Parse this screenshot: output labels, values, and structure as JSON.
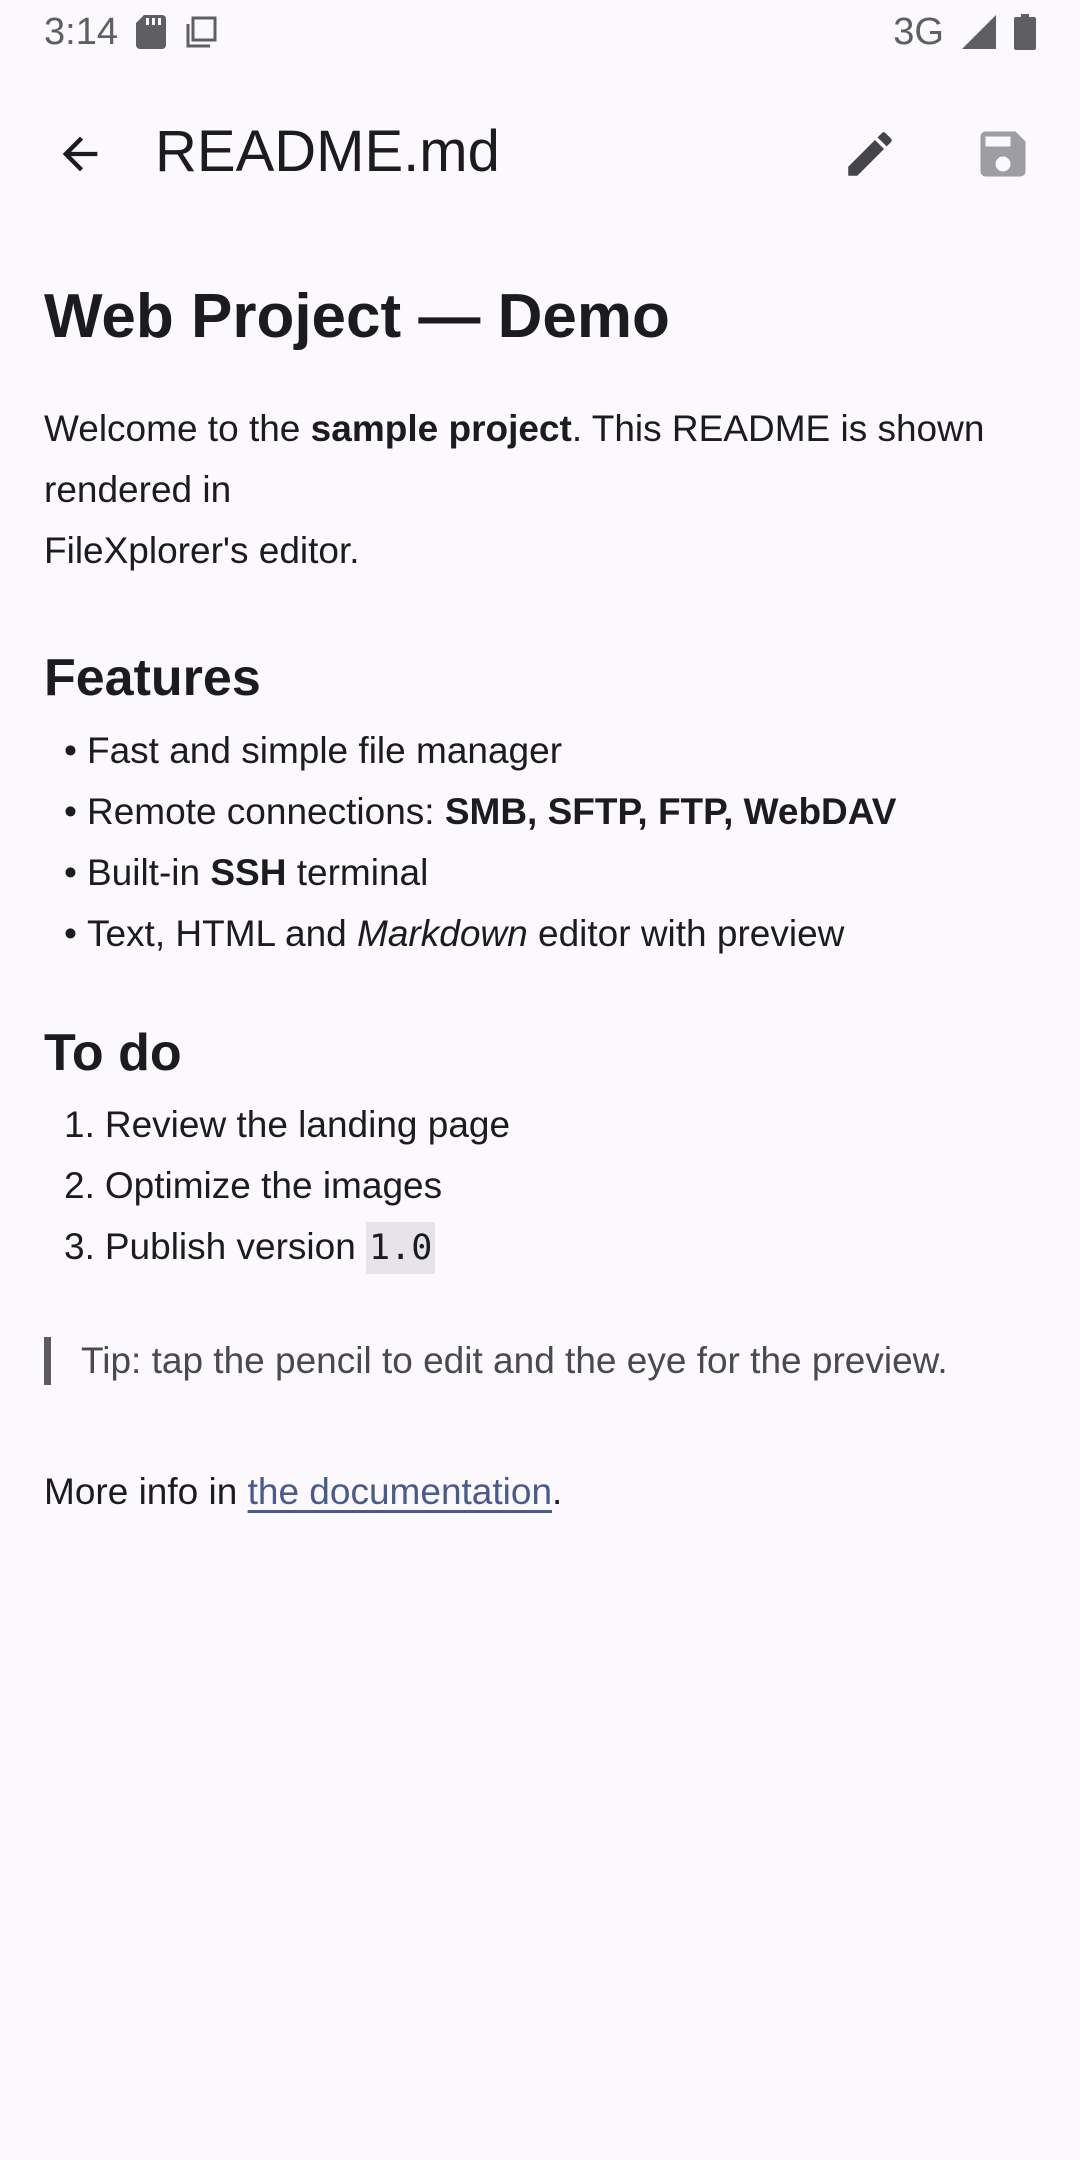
{
  "status_bar": {
    "time": "3:14",
    "network": "3G",
    "icons": [
      "sd-card-icon",
      "copy-icon",
      "signal-icon",
      "battery-icon"
    ]
  },
  "app_bar": {
    "title": "README.md",
    "icons": [
      "back-arrow-icon",
      "pencil-icon",
      "save-icon"
    ]
  },
  "document": {
    "title": "Web Project — Demo",
    "intro": {
      "pre": "Welcome to the ",
      "bold": "sample project",
      "post": ". This README is shown rendered in",
      "line2": "FileXplorer's editor."
    },
    "features": {
      "heading": "Features",
      "items": [
        {
          "pre": "Fast and simple file manager",
          "bold": "",
          "post": ""
        },
        {
          "pre": "Remote connections: ",
          "bold": "SMB, SFTP, FTP, WebDAV",
          "post": ""
        },
        {
          "pre": "Built-in ",
          "bold": "SSH",
          "post": " terminal"
        },
        {
          "pre": "Text, HTML and ",
          "italic": "Markdown",
          "post": " editor with preview"
        }
      ]
    },
    "todo": {
      "heading": "To do",
      "items": [
        {
          "num": "1.",
          "text": "Review the landing page"
        },
        {
          "num": "2.",
          "text": "Optimize the images"
        },
        {
          "num": "3.",
          "text": "Publish version ",
          "code": "1.0"
        }
      ]
    },
    "tip": "Tip: tap the pencil to edit and the eye for the preview.",
    "more_info": {
      "pre": "More info in ",
      "link": "the documentation",
      "post": "."
    }
  },
  "colors": {
    "background": "#fbf8fe",
    "text": "#1c1b1f",
    "link": "#4a5a8c",
    "code_bg": "#e6e3ea",
    "quote_bar": "#5c5a62"
  }
}
